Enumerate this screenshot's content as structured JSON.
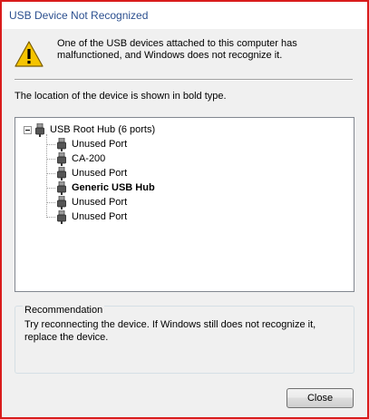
{
  "window": {
    "title": "USB Device Not Recognized"
  },
  "warning": {
    "icon": "warning-icon",
    "message": "One of the USB devices attached to this computer has malfunctioned, and Windows does not recognize it."
  },
  "location_text": "The location of the device is shown in bold type.",
  "tree": {
    "root": {
      "label": "USB Root Hub (6 ports)",
      "expanded": true
    },
    "children": [
      {
        "label": "Unused Port",
        "bold": false
      },
      {
        "label": "CA-200",
        "bold": false
      },
      {
        "label": "Unused Port",
        "bold": false
      },
      {
        "label": "Generic USB Hub",
        "bold": true
      },
      {
        "label": "Unused Port",
        "bold": false
      },
      {
        "label": "Unused Port",
        "bold": false
      }
    ]
  },
  "recommendation": {
    "title": "Recommendation",
    "text": "Try reconnecting the device. If Windows still does not recognize it, replace the device."
  },
  "buttons": {
    "close_label": "Close"
  },
  "colors": {
    "frame_border": "#d91c1c",
    "title_text": "#2b4f8f",
    "dialog_bg": "#f0f0f0"
  }
}
